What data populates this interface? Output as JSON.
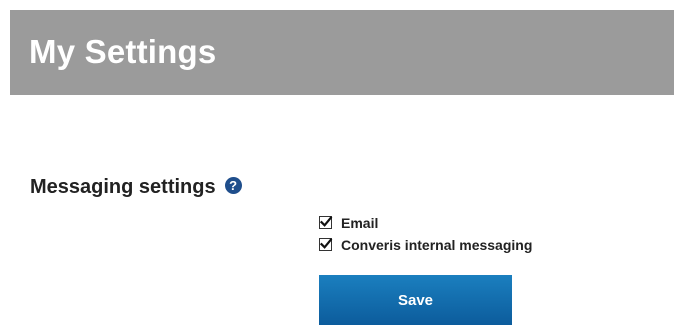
{
  "header": {
    "title": "My Settings"
  },
  "messaging": {
    "title": "Messaging settings",
    "help_icon_glyph": "?",
    "options": [
      {
        "label": "Email",
        "checked": true
      },
      {
        "label": "Converis internal messaging",
        "checked": true
      }
    ],
    "save_label": "Save"
  },
  "colors": {
    "header_bg": "#9b9b9b",
    "accent": "#0c6aa8",
    "help_icon": "#1f4e8c"
  },
  "icons": {
    "help": "question-circle-icon",
    "check": "checkmark-icon"
  }
}
